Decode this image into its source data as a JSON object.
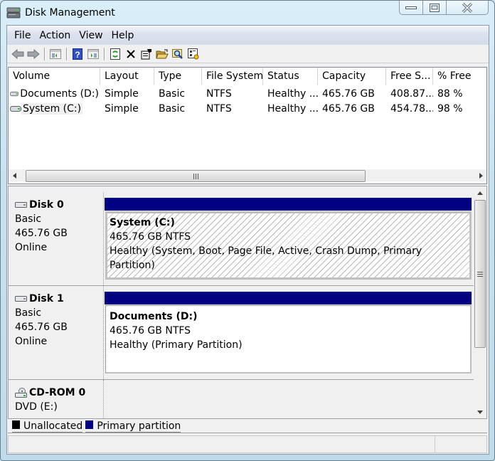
{
  "window": {
    "title": "Disk Management",
    "controls": [
      "minimize",
      "maximize",
      "close"
    ]
  },
  "menubar": {
    "items": [
      "File",
      "Action",
      "View",
      "Help"
    ]
  },
  "toolbar": {
    "buttons": [
      "back-icon",
      "forward-icon",
      "show-hide-console-tree-icon",
      "help-icon",
      "show-hide-action-pane-icon",
      "refresh-icon",
      "delete-icon",
      "properties-icon",
      "open-icon",
      "explore-icon",
      "settings-icon"
    ]
  },
  "volume_list": {
    "columns": [
      "Volume",
      "Layout",
      "Type",
      "File System",
      "Status",
      "Capacity",
      "Free S...",
      "% Free"
    ],
    "rows": [
      {
        "volume": "Documents (D:)",
        "layout": "Simple",
        "type": "Basic",
        "fs": "NTFS",
        "status": "Healthy ...",
        "capacity": "465.76 GB",
        "free": "408.87...",
        "pct_free": "88 %"
      },
      {
        "volume": "System (C:)",
        "layout": "Simple",
        "type": "Basic",
        "fs": "NTFS",
        "status": "Healthy ...",
        "capacity": "465.76 GB",
        "free": "454.78...",
        "pct_free": "98 %"
      }
    ]
  },
  "disks": [
    {
      "name": "Disk 0",
      "type": "Basic",
      "size": "465.76 GB",
      "state": "Online",
      "partition": {
        "title": "System  (C:)",
        "size_fs": "465.76 GB NTFS",
        "status": "Healthy (System, Boot, Page File, Active, Crash Dump, Primary Partition)",
        "selected": true
      }
    },
    {
      "name": "Disk 1",
      "type": "Basic",
      "size": "465.76 GB",
      "state": "Online",
      "partition": {
        "title": "Documents  (D:)",
        "size_fs": "465.76 GB NTFS",
        "status": "Healthy (Primary Partition)",
        "selected": false
      }
    },
    {
      "name": "CD-ROM 0",
      "type": "DVD (E:)"
    }
  ],
  "legend": [
    {
      "label": "Unallocated",
      "color": "#000000"
    },
    {
      "label": "Primary partition",
      "color": "#000080"
    }
  ],
  "colors": {
    "primary_partition": "#000080",
    "unallocated": "#000000"
  }
}
